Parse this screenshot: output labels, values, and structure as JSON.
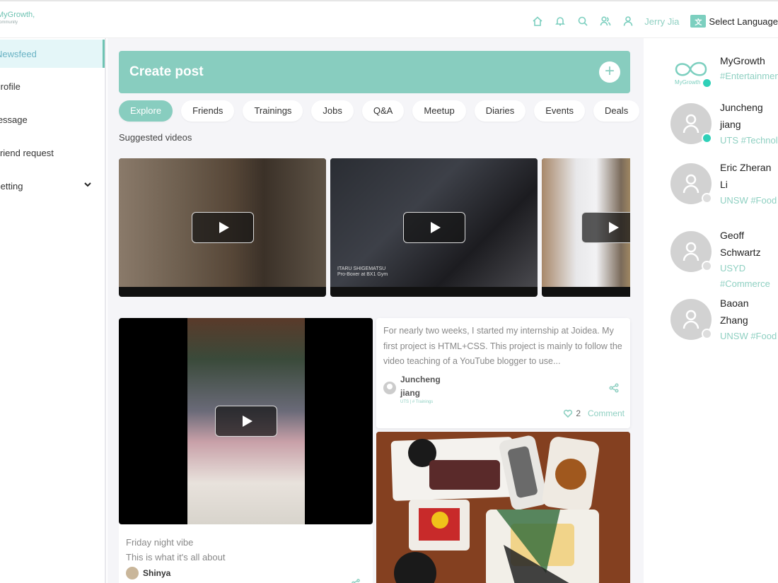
{
  "header": {
    "logo_line1": "MyGrowth,",
    "logo_line2": "community",
    "icons": [
      "home-icon",
      "bell-icon",
      "search-icon",
      "users-icon",
      "user-icon"
    ],
    "username": "Jerry Jia",
    "language": "Select Language",
    "accent": "#88cdbf"
  },
  "sidebar": {
    "items": [
      {
        "label": "Newsfeed"
      },
      {
        "label": "Profile"
      },
      {
        "label": "Message"
      },
      {
        "label": "Friend request"
      },
      {
        "label": "Setting"
      }
    ]
  },
  "create_post": {
    "label": "Create post"
  },
  "tabs": [
    "Explore",
    "Friends",
    "Trainings",
    "Jobs",
    "Q&A",
    "Meetup",
    "Diaries",
    "Events",
    "Deals"
  ],
  "suggested": {
    "title": "Suggested videos",
    "videos": [
      {
        "caption": ""
      },
      {
        "caption_line1": "ITARU SHIGEMATSU",
        "caption_line2": "Pro-Boxer at BX1 Gym"
      },
      {
        "caption": ""
      }
    ]
  },
  "feed": {
    "video_post": {
      "line1": "Friday night vibe",
      "line2": "This is what it's all about",
      "author": "Shinya"
    },
    "text_post": {
      "body": "For nearly two weeks, I started my internship at Joidea. My first project is HTML+CSS. This project is mainly to follow the video teaching of a YouTube blogger to use...",
      "author_line1": "Juncheng",
      "author_line2": "jiang",
      "meta": "UTS | # Trainings",
      "likes": "2",
      "comment_label": "Comment"
    }
  },
  "right_panel": {
    "people": [
      {
        "name1": "MyGrowth",
        "name2": "",
        "tag1": "#Entertainment",
        "tag2": "",
        "status": "online",
        "logo_text": "MyGrowth"
      },
      {
        "name1": "Juncheng",
        "name2": "jiang",
        "tag1": "UTS #Technology",
        "tag2": "",
        "status": "online"
      },
      {
        "name1": "Eric Zheran",
        "name2": "Li",
        "tag1": "UNSW #Food",
        "tag2": "",
        "status": "offline"
      },
      {
        "name1": "Geoff",
        "name2": "Schwartz",
        "tag1": "USYD",
        "tag2": "#Commerce",
        "status": "offline"
      },
      {
        "name1": "Baoan",
        "name2": "Zhang",
        "tag1": "UNSW #Food",
        "tag2": "",
        "status": "offline"
      }
    ],
    "online_color": "#2fd0b8",
    "offline_color": "#dddddd"
  }
}
